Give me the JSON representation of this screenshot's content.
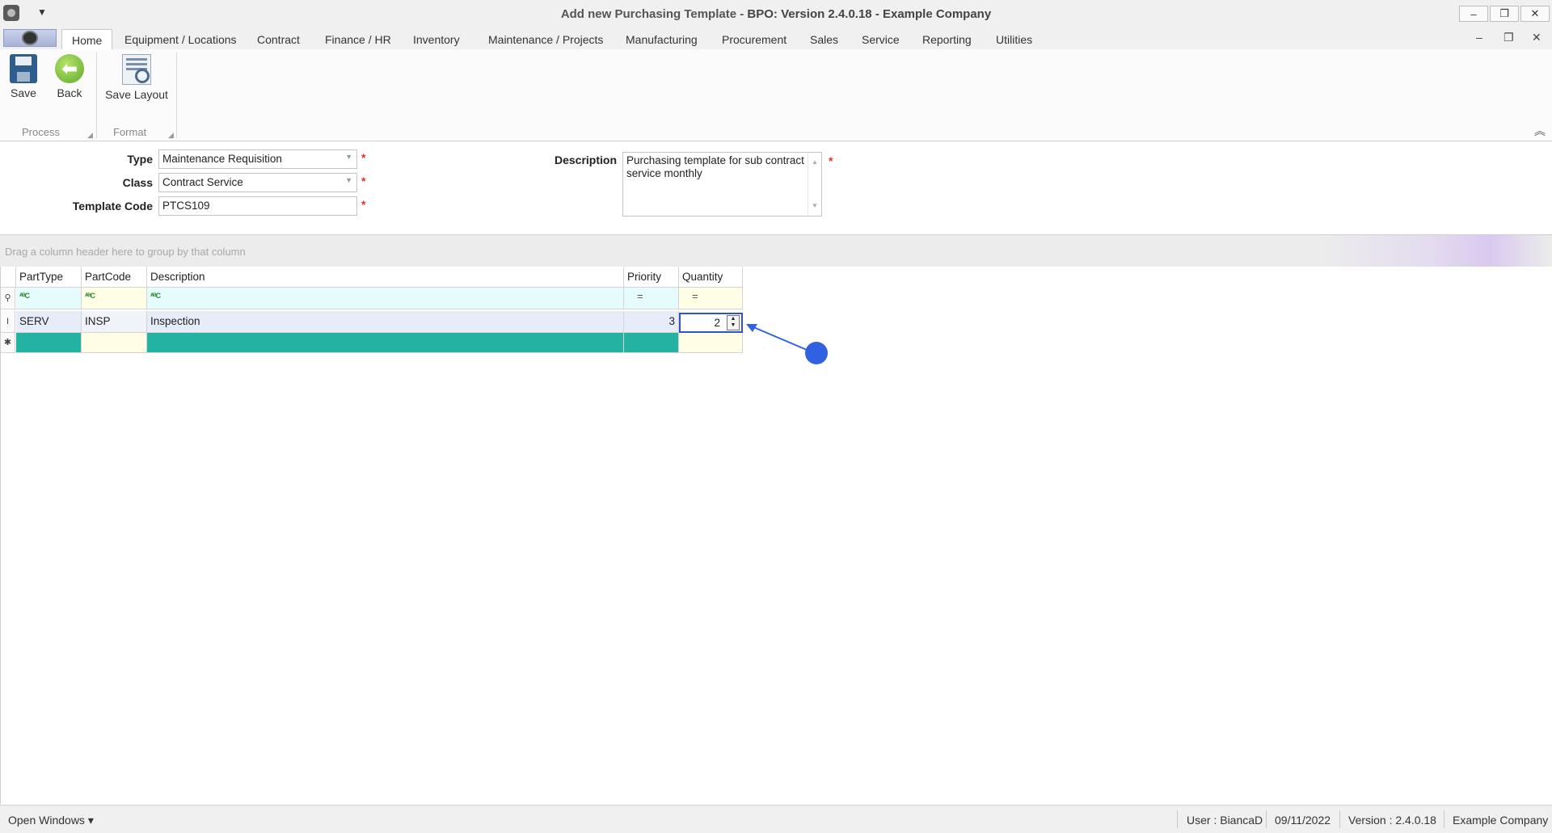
{
  "window": {
    "title_prefix": "Add new Purchasing Template - ",
    "title_main": "BPO: Version 2.4.0.18 - Example Company",
    "minimize": "–",
    "restore": "❐",
    "close": "✕"
  },
  "ribbon": {
    "tabs": [
      "Home",
      "Equipment / Locations",
      "Contract",
      "Finance / HR",
      "Inventory",
      "Maintenance / Projects",
      "Manufacturing",
      "Procurement",
      "Sales",
      "Service",
      "Reporting",
      "Utilities"
    ],
    "save_label": "Save",
    "back_label": "Back",
    "save_layout_label": "Save Layout",
    "group_process": "Process",
    "group_format": "Format"
  },
  "form": {
    "type_label": "Type",
    "type_value": "Maintenance Requisition",
    "class_label": "Class",
    "class_value": "Contract Service",
    "template_code_label": "Template Code",
    "template_code_value": "PTCS109",
    "description_label": "Description",
    "description_value": "Purchasing template for sub contract service monthly",
    "required_mark": "*"
  },
  "grid": {
    "group_hint": "Drag a column header here to group by that column",
    "columns": [
      "PartType",
      "PartCode",
      "Description",
      "Priority",
      "Quantity"
    ],
    "rows": [
      {
        "parttype": "SERV",
        "partcode": "INSP",
        "description": "Inspection",
        "priority": "3",
        "quantity": "2"
      }
    ]
  },
  "status": {
    "open_windows": "Open Windows ▾",
    "user": "User : BiancaD",
    "date": "09/11/2022",
    "version": "Version : 2.4.0.18",
    "company": "Example Company"
  },
  "colors": {
    "accent": "#3061e0",
    "new_row": "#24b3a3",
    "required": "#e03030"
  }
}
